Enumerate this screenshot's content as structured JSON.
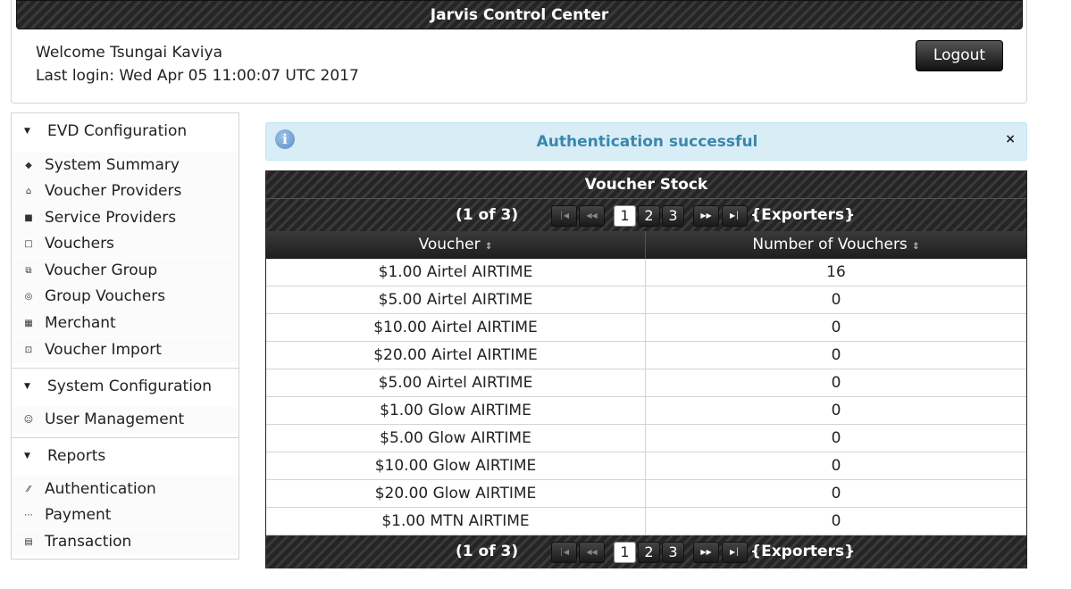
{
  "header": {
    "title": "Jarvis Control Center",
    "welcome": "Welcome Tsungai Kaviya",
    "last_login": "Last login: Wed Apr 05 11:00:07 UTC 2017",
    "logout_label": "Logout"
  },
  "sidebar": {
    "sections": [
      {
        "label": "EVD Configuration",
        "items": [
          {
            "label": "System Summary",
            "icon": "tag-icon"
          },
          {
            "label": "Voucher Providers",
            "icon": "home-icon"
          },
          {
            "label": "Service Providers",
            "icon": "folder-icon"
          },
          {
            "label": "Vouchers",
            "icon": "document-icon"
          },
          {
            "label": "Voucher Group",
            "icon": "copy-icon"
          },
          {
            "label": "Group Vouchers",
            "icon": "disk-icon"
          },
          {
            "label": "Merchant",
            "icon": "calculator-icon"
          },
          {
            "label": "Voucher Import",
            "icon": "import-icon"
          }
        ]
      },
      {
        "label": "System Configuration",
        "items": [
          {
            "label": "User Management",
            "icon": "person-icon"
          }
        ]
      },
      {
        "label": "Reports",
        "items": [
          {
            "label": "Authentication",
            "icon": "pencil-icon"
          },
          {
            "label": "Payment",
            "icon": "grip-icon"
          },
          {
            "label": "Transaction",
            "icon": "cart-icon"
          }
        ]
      }
    ]
  },
  "alert": {
    "message": "Authentication successful",
    "close_label": "×",
    "icon_glyph": "i"
  },
  "table": {
    "title": "Voucher Stock",
    "page_report": "(1 of 3)",
    "pages": [
      "1",
      "2",
      "3"
    ],
    "current_page": "1",
    "exporters_label": "{Exporters}",
    "columns": [
      "Voucher",
      "Number of Vouchers"
    ],
    "rows": [
      [
        "$1.00 Airtel AIRTIME",
        "16"
      ],
      [
        "$5.00 Airtel AIRTIME",
        "0"
      ],
      [
        "$10.00 Airtel AIRTIME",
        "0"
      ],
      [
        "$20.00 Airtel AIRTIME",
        "0"
      ],
      [
        "$5.00 Airtel AIRTIME",
        "0"
      ],
      [
        "$1.00 Glow AIRTIME",
        "0"
      ],
      [
        "$5.00 Glow AIRTIME",
        "0"
      ],
      [
        "$10.00 Glow AIRTIME",
        "0"
      ],
      [
        "$20.00 Glow AIRTIME",
        "0"
      ],
      [
        "$1.00 MTN AIRTIME",
        "0"
      ]
    ]
  }
}
